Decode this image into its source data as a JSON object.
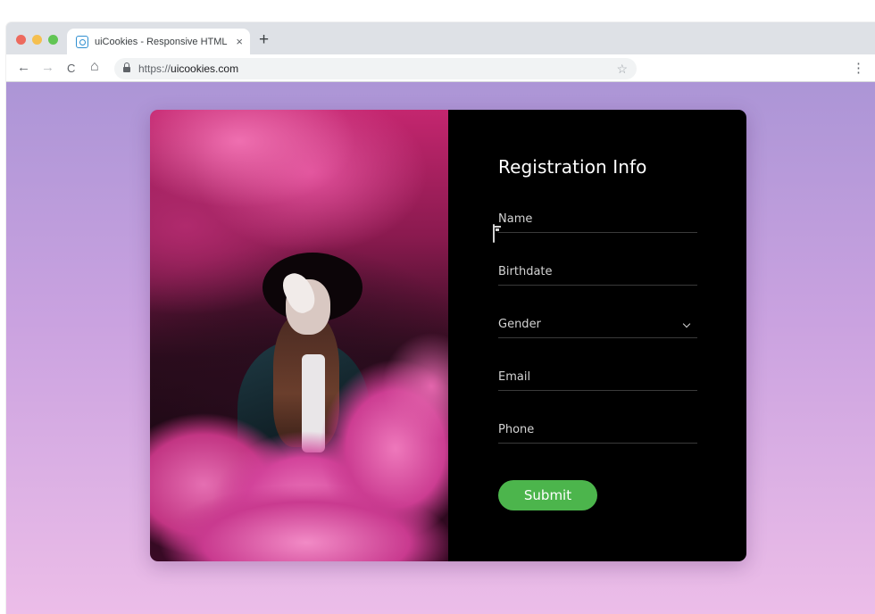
{
  "browser": {
    "tab_title": "uiCookies - Responsive HTML",
    "tab_close": "×",
    "new_tab": "+",
    "url_scheme": "https://",
    "url_host": "uicookies.com",
    "nav": {
      "back": "←",
      "forward": "→",
      "reload": "C",
      "home": "⌂"
    },
    "star": "☆",
    "menu": "⋮",
    "traffic_colors": [
      "#ed6a5e",
      "#f5bf4f",
      "#61c554"
    ]
  },
  "form": {
    "title": "Registration Info",
    "fields": [
      {
        "placeholder": "Name",
        "icon": null
      },
      {
        "placeholder": "Birthdate",
        "icon": "calendar-icon"
      },
      {
        "placeholder": "Gender",
        "icon": "chevron-down-icon"
      },
      {
        "placeholder": "Email",
        "icon": null
      },
      {
        "placeholder": "Phone",
        "icon": null
      }
    ],
    "submit_label": "Submit",
    "submit_color": "#4cb54c"
  },
  "colors": {
    "panel_bg": "#000000",
    "page_gradient": [
      "#ac95d6",
      "#ecbde8"
    ],
    "photo_accent": "#e0509a"
  }
}
